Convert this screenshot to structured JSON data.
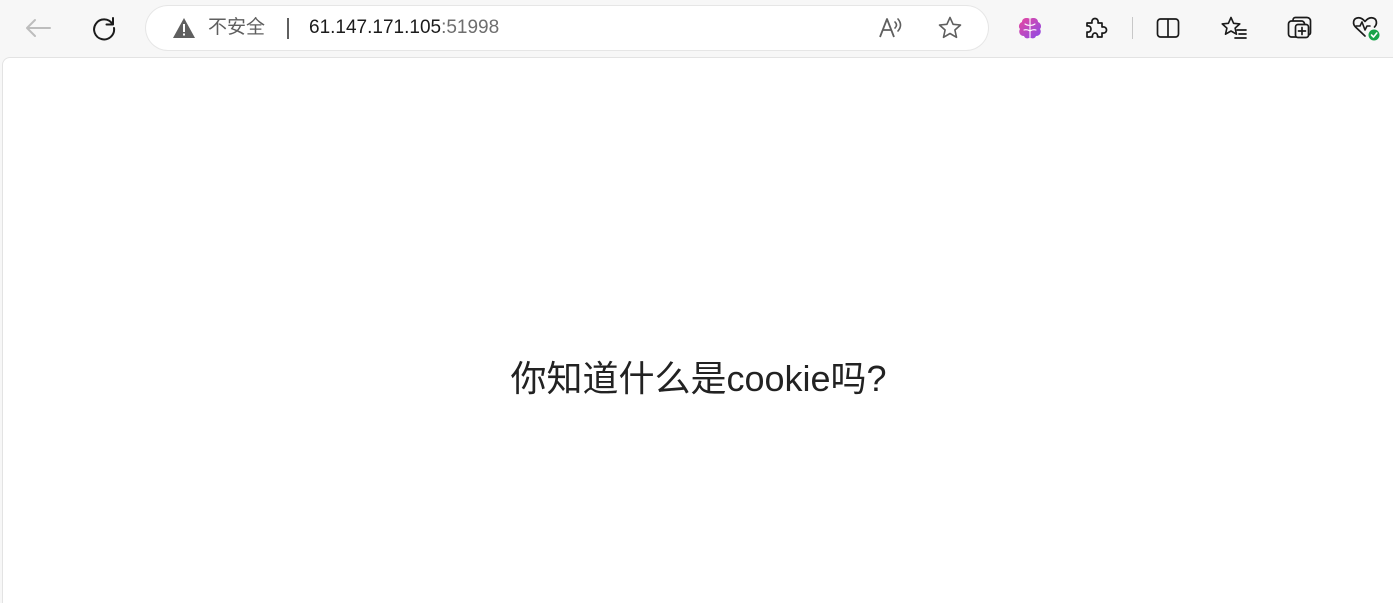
{
  "browser": {
    "toolbar": {
      "back_icon": "arrow-left-icon",
      "refresh_icon": "refresh-icon"
    },
    "address_bar": {
      "security_icon": "warning-triangle-icon",
      "security_label": "不安全",
      "url_host": "61.147.171.105",
      "url_port": ":51998",
      "read_aloud_icon": "read-aloud-icon",
      "favorite_icon": "star-icon"
    },
    "extensions": {
      "brain_extension_icon": "brain-icon",
      "extensions_icon": "puzzle-icon"
    },
    "actions": {
      "split_screen_icon": "split-screen-icon",
      "favorites_icon": "favorites-list-icon",
      "collections_icon": "collections-icon",
      "performance_icon": "heartbeat-icon"
    },
    "colors": {
      "toolbar_bg": "#f7f7f7",
      "page_bg": "#ffffff",
      "brain_pink": "#e8489f",
      "brain_purple": "#8b4be8",
      "status_green": "#1aa34a"
    }
  },
  "page": {
    "message": "你知道什么是cookie吗?"
  }
}
